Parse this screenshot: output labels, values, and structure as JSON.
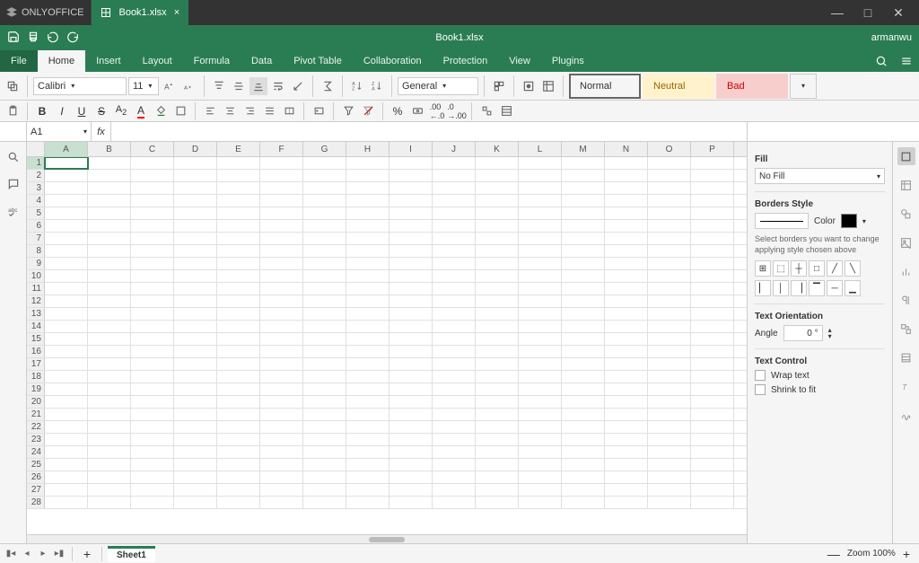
{
  "titlebar": {
    "brand": "ONLYOFFICE",
    "doc_name": "Book1.xlsx"
  },
  "header": {
    "title": "Book1.xlsx",
    "user": "armanwu"
  },
  "menu": {
    "file": "File",
    "home": "Home",
    "insert": "Insert",
    "layout": "Layout",
    "formula": "Formula",
    "data": "Data",
    "pivot": "Pivot Table",
    "collab": "Collaboration",
    "protect": "Protection",
    "view": "View",
    "plugins": "Plugins"
  },
  "ribbon": {
    "font": "Calibri",
    "font_size": "11",
    "number_format": "General",
    "styles": {
      "normal": "Normal",
      "neutral": "Neutral",
      "bad": "Bad"
    }
  },
  "formula_bar": {
    "cell_ref": "A1",
    "value": ""
  },
  "columns": [
    "A",
    "B",
    "C",
    "D",
    "E",
    "F",
    "G",
    "H",
    "I",
    "J",
    "K",
    "L",
    "M",
    "N",
    "O",
    "P"
  ],
  "side_panel": {
    "fill_title": "Fill",
    "fill_value": "No Fill",
    "borders_title": "Borders Style",
    "color_label": "Color",
    "borders_help": "Select borders you want to change applying style chosen above",
    "orient_title": "Text Orientation",
    "angle_label": "Angle",
    "angle_value": "0 °",
    "control_title": "Text Control",
    "wrap": "Wrap text",
    "shrink": "Shrink to fit"
  },
  "sheets": {
    "active": "Sheet1"
  },
  "status": {
    "zoom": "Zoom 100%"
  }
}
